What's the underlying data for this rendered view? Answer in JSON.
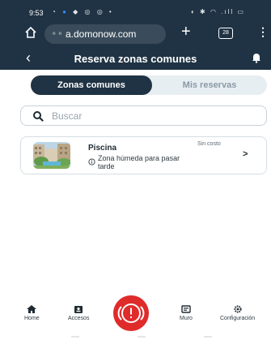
{
  "status_bar": {
    "time": "9:53"
  },
  "browser": {
    "url": "a.domonow.com",
    "tabs_count": "28"
  },
  "header": {
    "title": "Reserva zonas comunes"
  },
  "segments": {
    "active": "Zonas comunes",
    "inactive": "Mis reservas"
  },
  "search": {
    "placeholder": "Buscar"
  },
  "zones": [
    {
      "name": "Piscina",
      "cost": "Sin costo",
      "description": "Zona húmeda para pasar tarde"
    }
  ],
  "bottom_nav": {
    "home": "Home",
    "access": "Accesos",
    "wall": "Muro",
    "settings": "Configuración"
  },
  "colors": {
    "header_bg": "#1f3344",
    "sos_red": "#e02b2b",
    "segment_bg": "#e7eef2"
  }
}
